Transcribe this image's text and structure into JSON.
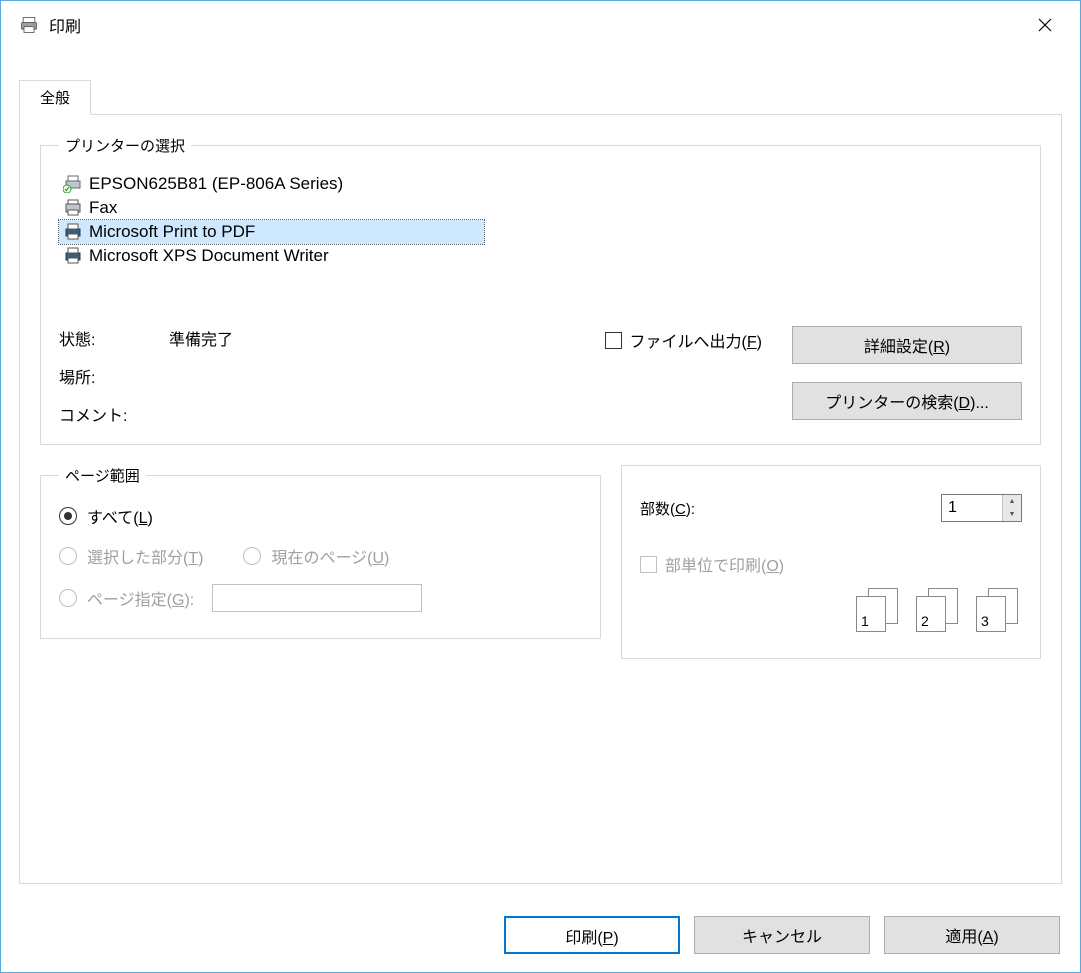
{
  "titlebar": {
    "title": "印刷"
  },
  "tabs": {
    "general": "全般"
  },
  "printer_select": {
    "legend": "プリンターの選択",
    "items": [
      {
        "name": "EPSON625B81 (EP-806A Series)",
        "selected": false,
        "icon": "printer-ready"
      },
      {
        "name": "Fax",
        "selected": false,
        "icon": "printer-fax"
      },
      {
        "name": "Microsoft Print to PDF",
        "selected": true,
        "icon": "printer-virtual"
      },
      {
        "name": "Microsoft XPS Document Writer",
        "selected": false,
        "icon": "printer-virtual"
      }
    ],
    "status_label": "状態:",
    "status_value": "準備完了",
    "location_label": "場所:",
    "location_value": "",
    "comment_label": "コメント:",
    "comment_value": "",
    "file_output_label_pre": "ファイルへ出力(",
    "file_output_accel": "F",
    "file_output_label_post": ")",
    "advanced_btn_pre": "詳細設定(",
    "advanced_btn_accel": "R",
    "advanced_btn_post": ")",
    "find_btn_pre": "プリンターの検索(",
    "find_btn_accel": "D",
    "find_btn_post": ")..."
  },
  "page_range": {
    "legend": "ページ範囲",
    "all_pre": "すべて(",
    "all_accel": "L",
    "all_post": ")",
    "selection_pre": "選択した部分(",
    "selection_accel": "T",
    "selection_post": ")",
    "current_pre": "現在のページ(",
    "current_accel": "U",
    "current_post": ")",
    "pages_pre": "ページ指定(",
    "pages_accel": "G",
    "pages_post": "):",
    "selected": "all"
  },
  "copies": {
    "count_label_pre": "部数(",
    "count_label_accel": "C",
    "count_label_post": "):",
    "count_value": "1",
    "collate_pre": "部単位で印刷(",
    "collate_accel": "O",
    "collate_post": ")",
    "icons": [
      "1",
      "2",
      "3"
    ]
  },
  "buttons": {
    "print_pre": "印刷(",
    "print_accel": "P",
    "print_post": ")",
    "cancel": "キャンセル",
    "apply_pre": "適用(",
    "apply_accel": "A",
    "apply_post": ")"
  }
}
